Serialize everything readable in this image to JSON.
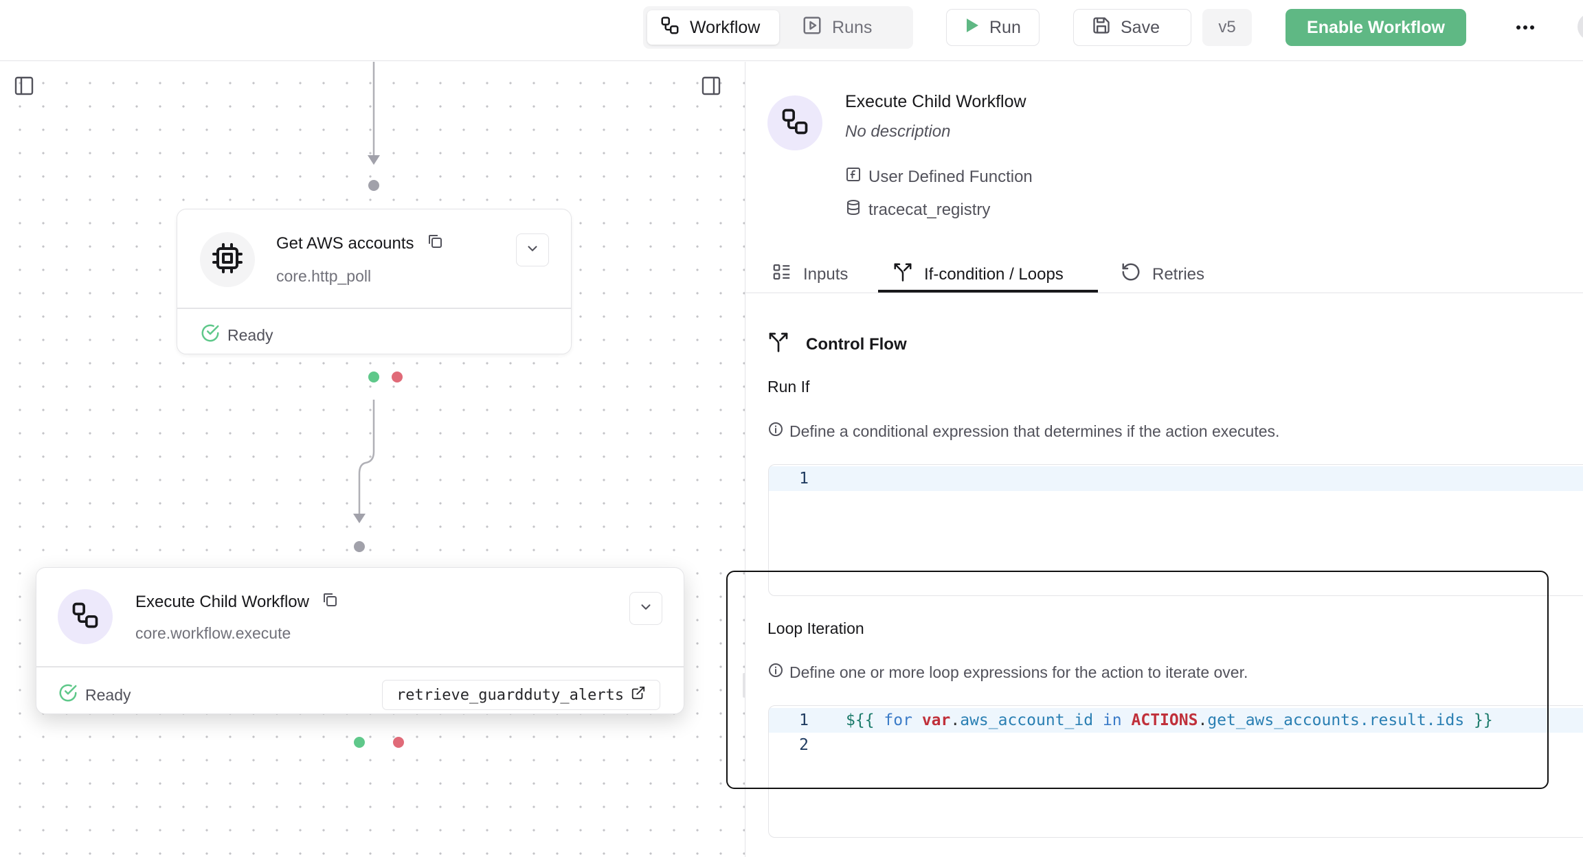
{
  "topbar": {
    "tabs": [
      {
        "label": "Workflow",
        "icon": "workflow-icon",
        "active": true
      },
      {
        "label": "Runs",
        "icon": "play-square-icon",
        "active": false
      }
    ],
    "run_label": "Run",
    "save_label": "Save",
    "version": "v5",
    "enable_label": "Enable Workflow"
  },
  "canvas": {
    "nodes": [
      {
        "title": "Get AWS accounts",
        "subtitle": "core.http_poll",
        "icon": "cpu-icon",
        "status": "Ready"
      },
      {
        "title": "Execute Child Workflow",
        "subtitle": "core.workflow.execute",
        "icon": "workflow-icon",
        "status": "Ready",
        "link_label": "retrieve_guardduty_alerts"
      }
    ]
  },
  "panel": {
    "title": "Execute Child Workflow",
    "description": "No description",
    "type_label": "User Defined Function",
    "registry_label": "tracecat_registry",
    "tabs": [
      {
        "label": "Inputs",
        "active": false
      },
      {
        "label": "If-condition / Loops",
        "active": true
      },
      {
        "label": "Retries",
        "active": false
      }
    ],
    "section_title": "Control Flow",
    "run_if": {
      "label": "Run If",
      "help": "Define a conditional expression that determines if the action executes.",
      "line_numbers": [
        "1"
      ]
    },
    "loop": {
      "label": "Loop Iteration",
      "help": "Define one or more loop expressions for the action to iterate over.",
      "line_numbers": [
        "1",
        "2"
      ],
      "code": {
        "open": "${{",
        "kw_for": "for",
        "var": "var",
        "var_attr": "aws_account_id",
        "kw_in": "in",
        "actions": "ACTIONS",
        "actions_attr": "get_aws_accounts.result.ids",
        "close": "}}"
      }
    }
  },
  "colors": {
    "accent_green": "#5fb884",
    "icon_bg_purple": "#ede9fb",
    "handle_green": "#5fc88a",
    "handle_red": "#e06a78"
  }
}
